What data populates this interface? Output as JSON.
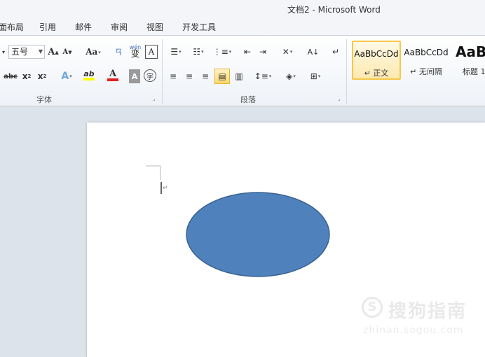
{
  "window": {
    "title": "文档2 - Microsoft Word"
  },
  "menu": {
    "items": [
      "面布局",
      "引用",
      "邮件",
      "审阅",
      "视图",
      "开发工具"
    ]
  },
  "font_group": {
    "label": "字体",
    "font_size": "五号",
    "grow_font": "A",
    "shrink_font": "A",
    "change_case": "Aa",
    "phonetic_guide": "wén",
    "phonetic_char": "变",
    "char_border": "A",
    "strikethrough": "abc",
    "subscript": "x",
    "superscript": "x",
    "text_effects": "A",
    "highlight": "ab",
    "font_color": "A",
    "char_shading": "A",
    "enclose_char": "字",
    "font_color_hex": "#e02020",
    "highlight_hex": "#ffff00"
  },
  "paragraph_group": {
    "label": "段落",
    "sort": "A↓"
  },
  "styles_group": {
    "styles": [
      {
        "sample": "AaBbCcDd",
        "name": "↵ 正文",
        "selected": true
      },
      {
        "sample": "AaBbCcDd",
        "name": "↵ 无间隔",
        "selected": false
      },
      {
        "sample": "AaB",
        "name": "标题 1",
        "selected": false
      }
    ]
  },
  "document": {
    "shape": {
      "type": "ellipse",
      "fill": "#4f81bd",
      "stroke": "#3a6391"
    }
  },
  "watermark": {
    "logo": "S",
    "text": "搜狗指南",
    "url": "zhinan.sogou.com"
  }
}
